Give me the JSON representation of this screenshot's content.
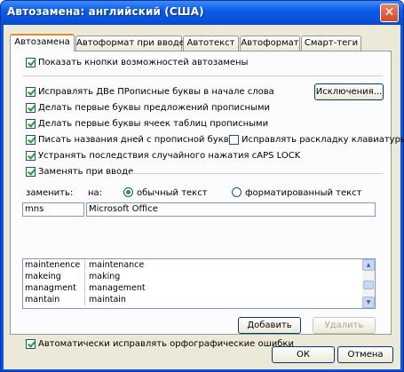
{
  "window": {
    "title": "Автозамена: английский (США)",
    "close_glyph": "✕"
  },
  "tabs": [
    {
      "label": "Автозамена",
      "active": true
    },
    {
      "label": "Автоформат при вводе",
      "active": false
    },
    {
      "label": "Автотекст",
      "active": false
    },
    {
      "label": "Автоформат",
      "active": false
    },
    {
      "label": "Смарт-теги",
      "active": false
    }
  ],
  "options": {
    "show_buttons": {
      "label": "Показать кнопки возможностей автозамены",
      "checked": true
    },
    "two_caps": {
      "label": "Исправлять ДВе ПРописные буквы в начале слова",
      "checked": true
    },
    "sentence_caps": {
      "label": "Делать первые буквы предложений прописными",
      "checked": true
    },
    "cell_caps": {
      "label": "Делать первые буквы ячеек таблиц прописными",
      "checked": true
    },
    "day_names": {
      "label": "Писать названия дней с прописной буквы",
      "checked": true
    },
    "keyboard_layout": {
      "label": "Исправлять раскладку клавиатуры",
      "checked": false
    },
    "caps_lock": {
      "label": "Устранять последствия случайного нажатия cAPS LOCK",
      "checked": true
    },
    "replace_typing": {
      "label": "Заменять при вводе",
      "checked": true
    },
    "auto_spelling": {
      "label": "Автоматически исправлять орфографические ошибки",
      "checked": true
    }
  },
  "exceptions_button": "Исключения...",
  "replace": {
    "replace_label": "заменить:",
    "with_label": "на:",
    "plain_text_label": "обычный текст",
    "formatted_text_label": "форматированный текст",
    "plain_selected": true,
    "replace_value": "mns",
    "with_value": "Microsoft Office"
  },
  "entries": [
    {
      "from": "maintenence",
      "to": "maintenance"
    },
    {
      "from": "makeing",
      "to": "making"
    },
    {
      "from": "managment",
      "to": "management"
    },
    {
      "from": "mantain",
      "to": "maintain"
    }
  ],
  "buttons": {
    "add": "Добавить",
    "delete": "Удалить",
    "ok": "ОК",
    "cancel": "Отмена"
  },
  "icons": {
    "scroll_up": "▲",
    "scroll_down": "▼"
  }
}
